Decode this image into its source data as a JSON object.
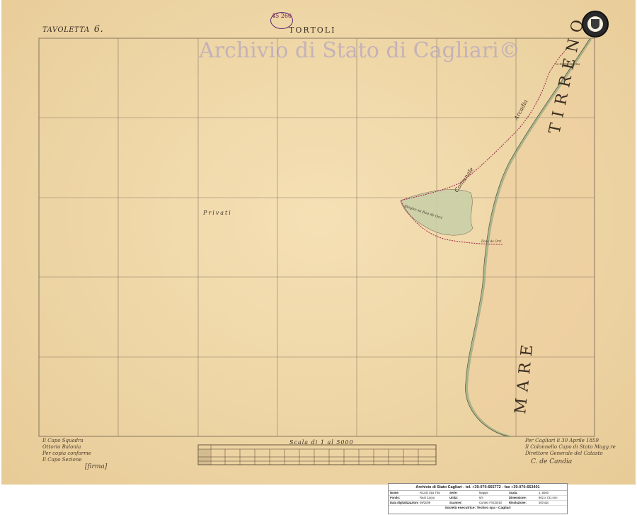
{
  "map": {
    "sheet_label": "TAVOLETTA",
    "sheet_number": "6.",
    "title": "TORTOLI",
    "watermark": "Archivio di Stato di Cagliari©",
    "stamp": "45 260",
    "label_privati": "Privati",
    "label_mare_upper": "TIRRENO",
    "label_mare_lower": "MARE",
    "label_comunale": "Comunale",
    "label_arcadia": "Arcadia",
    "label_stagno": "Stagno su fiuo de Orri",
    "label_foce": "Foce de Orri",
    "label_torre": "la torre Ancina",
    "scale_label": "Scala di 1 al 5000",
    "colors": {
      "paper": "#f0d8a8",
      "sea": "#eecfa0",
      "ink": "#3a2e22",
      "boundary": "#a03050",
      "coast": "#8aa880"
    }
  },
  "notes": {
    "left": [
      "Il Capo Squadra",
      "Ottorio Balonia",
      "Per copia conforme",
      "Il Capo Sezione"
    ],
    "left_sign": "[firma]",
    "right": [
      "Per Cagliari li 30 Aprile 1859",
      "Il Colonnello Capo di Stato Magg.re",
      "Direttore Generale del Catasto"
    ],
    "right_sign": "C. de Candia"
  },
  "infobox": {
    "header": "Archivio di Stato Cagliari - tel. +39-070-665772 - fax +39-070-653401",
    "rows": [
      [
        "Nome:",
        "RCSO 015 T06",
        "Serie:",
        "Mappe",
        "Scala:",
        "1: 5000"
      ],
      [
        "Fondo:",
        "Real Corpo",
        "Unità:",
        "6/4",
        "Dimensione:",
        "902 x 731 mm"
      ],
      [
        "Data digitalizzazione:",
        "09/2009",
        "Scanner:",
        "Contex FSC5010",
        "Risoluzione:",
        "200 dpi"
      ]
    ],
    "footer": "Società esecutrice: Techno spa - Cagliari"
  }
}
